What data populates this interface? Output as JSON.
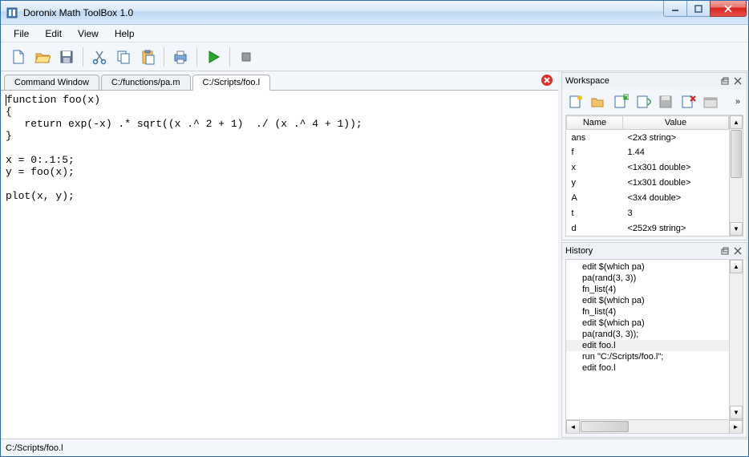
{
  "window": {
    "title": "Doronix Math ToolBox 1.0"
  },
  "menu": {
    "items": [
      "File",
      "Edit",
      "View",
      "Help"
    ]
  },
  "tabs": {
    "items": [
      {
        "label": "Command Window",
        "active": false
      },
      {
        "label": "C:/functions/pa.m",
        "active": false
      },
      {
        "label": "C:/Scripts/foo.l",
        "active": true
      }
    ]
  },
  "editor": {
    "content": "function foo(x)\n{\n   return exp(-x) .* sqrt((x .^ 2 + 1)  ./ (x .^ 4 + 1));\n}\n\nx = 0:.1:5;\ny = foo(x);\n\nplot(x, y);"
  },
  "workspace": {
    "title": "Workspace",
    "cols": {
      "name": "Name",
      "value": "Value"
    },
    "rows": [
      {
        "name": "ans",
        "value": "<2x3 string>"
      },
      {
        "name": "f",
        "value": "1.44"
      },
      {
        "name": "x",
        "value": "<1x301 double>"
      },
      {
        "name": "y",
        "value": "<1x301 double>"
      },
      {
        "name": "A",
        "value": "<3x4 double>"
      },
      {
        "name": "t",
        "value": "3"
      },
      {
        "name": "d",
        "value": "<252x9 string>"
      }
    ]
  },
  "history": {
    "title": "History",
    "items": [
      "edit $(which pa)",
      "pa(rand(3, 3))",
      "fn_list(4)",
      "edit $(which pa)",
      "fn_list(4)",
      "edit $(which pa)",
      "pa(rand(3, 3));",
      "edit foo.l",
      "run \"C:/Scripts/foo.l\";",
      "edit foo.l"
    ],
    "selected_index": 7
  },
  "status": {
    "text": "C:/Scripts/foo.l"
  }
}
